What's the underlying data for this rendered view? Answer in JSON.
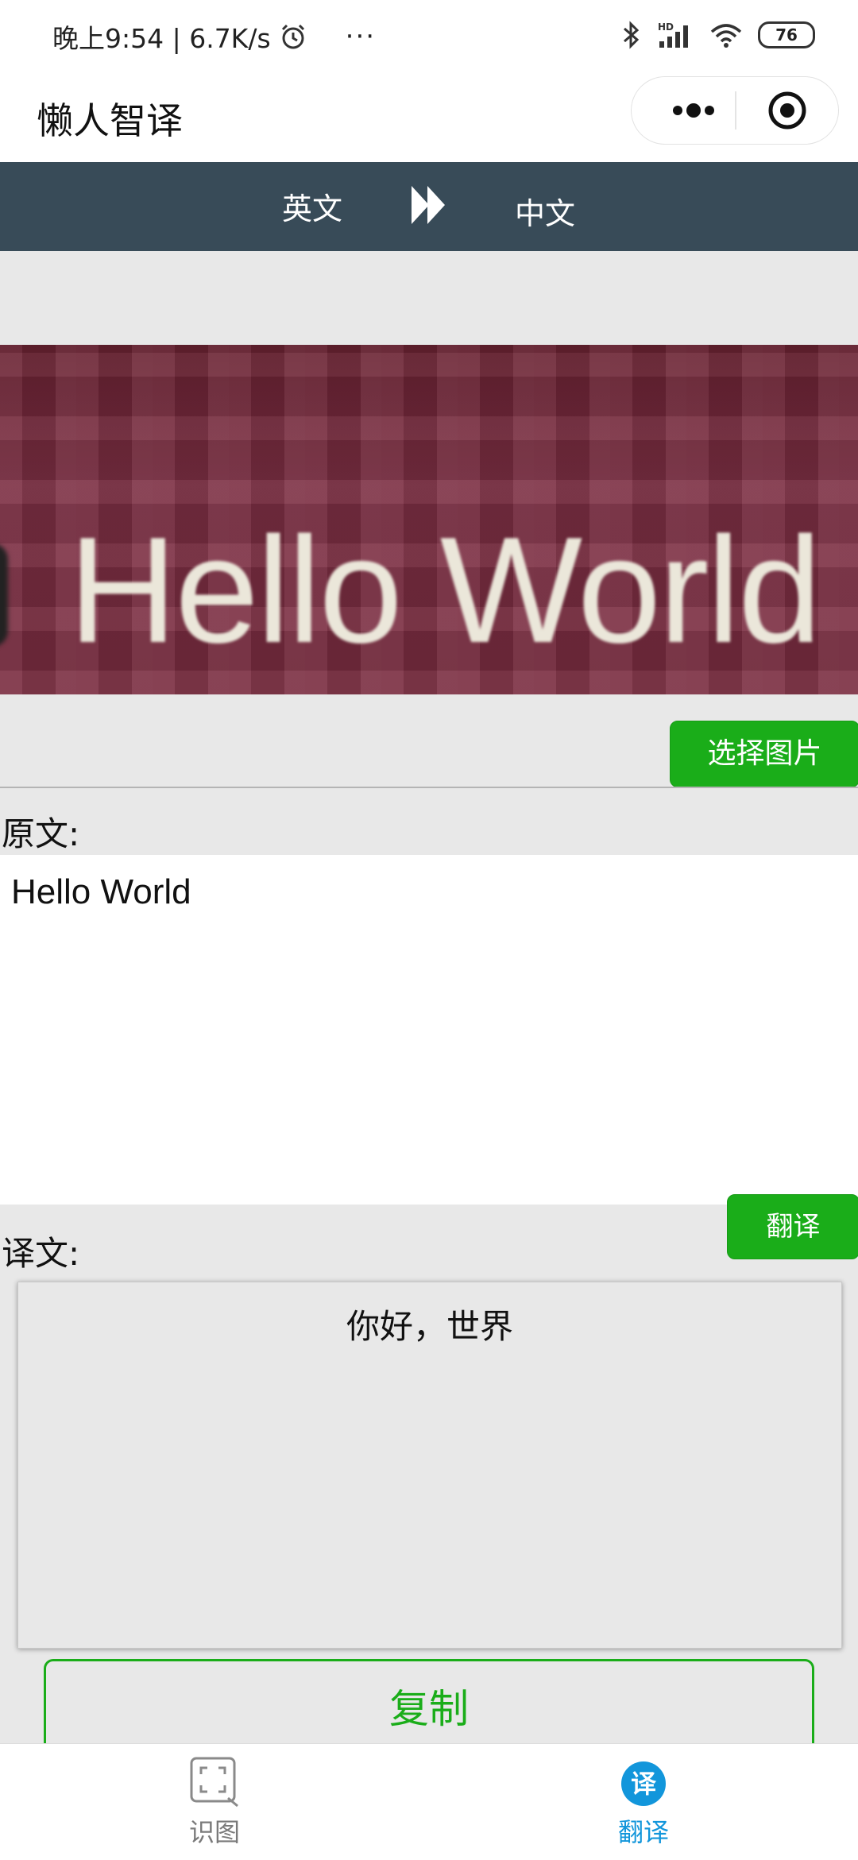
{
  "status_bar": {
    "time_net": "晚上9:54 | 6.7K/s",
    "more": "···",
    "network_label": "HD",
    "battery": "76"
  },
  "header": {
    "title": "懒人智译"
  },
  "language_bar": {
    "source_lang": "英文",
    "target_lang": "中文"
  },
  "image": {
    "text": "Hello World"
  },
  "actions": {
    "select_image": "选择图片",
    "translate": "翻译",
    "copy": "复制"
  },
  "source": {
    "label": "原文:",
    "text": "Hello World"
  },
  "result": {
    "label": "译文:",
    "text": "你好，世界"
  },
  "tabs": [
    {
      "label": "识图",
      "icon": "scan-icon",
      "active": false
    },
    {
      "label": "翻译",
      "icon": "translate-icon",
      "active": true,
      "badge": "译"
    }
  ],
  "colors": {
    "primary_green": "#1aad19",
    "lang_bar": "#384b58",
    "active_tab": "#1296db",
    "page_bg": "#e8e8e8"
  }
}
